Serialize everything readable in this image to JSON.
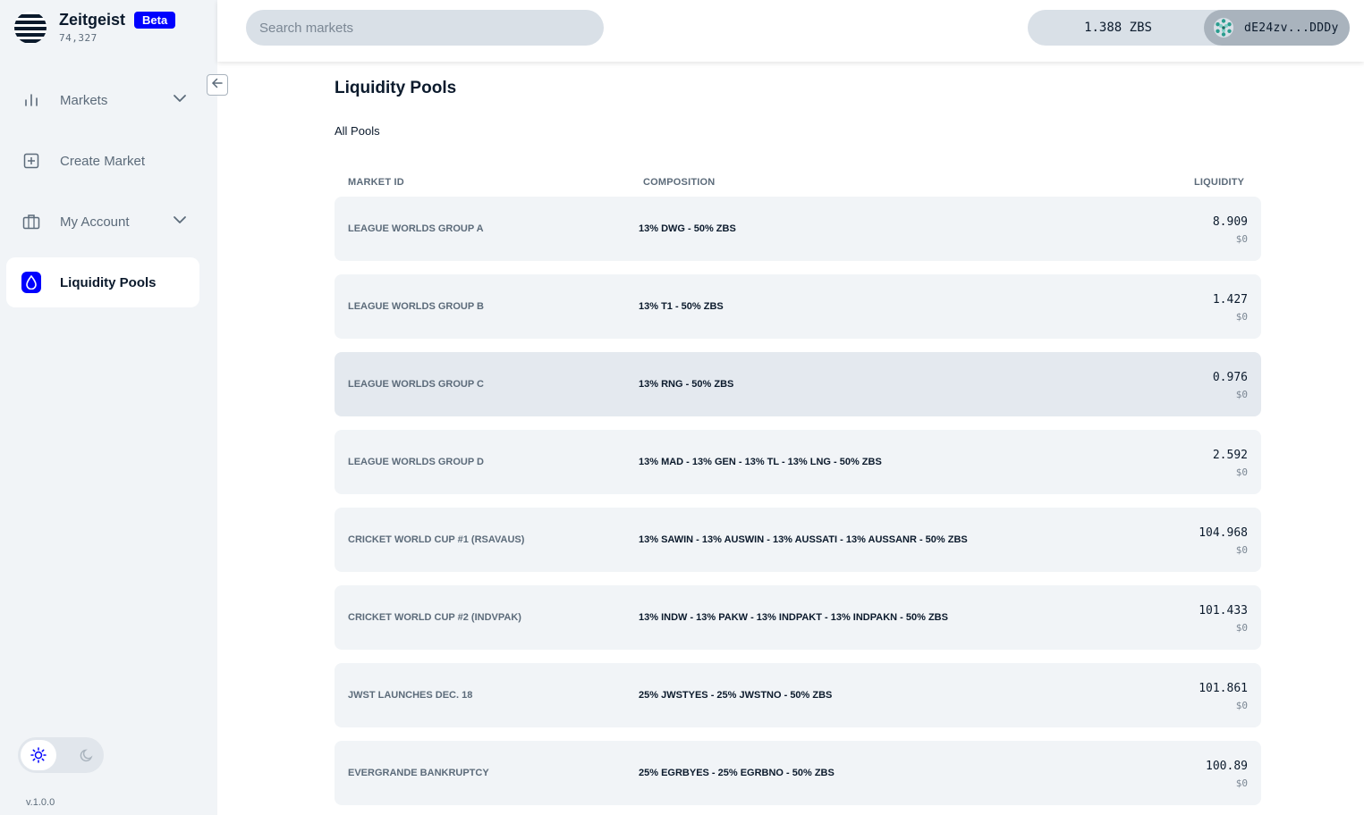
{
  "brand": {
    "name": "Zeitgeist",
    "badge": "Beta",
    "block_number": "74,327"
  },
  "sidebar": {
    "items": [
      {
        "label": "Markets",
        "icon": "bar-chart-icon",
        "has_dropdown": true,
        "active": false
      },
      {
        "label": "Create Market",
        "icon": "plus-square-icon",
        "has_dropdown": false,
        "active": false
      },
      {
        "label": "My Account",
        "icon": "briefcase-icon",
        "has_dropdown": true,
        "active": false
      },
      {
        "label": "Liquidity Pools",
        "icon": "droplet-icon",
        "has_dropdown": false,
        "active": true
      }
    ],
    "theme": {
      "selected": "light"
    },
    "version": "v.1.0.0"
  },
  "header": {
    "search_placeholder": "Search markets",
    "balance": "1.388 ZBS",
    "address": "dE24zv...DDDy"
  },
  "main": {
    "title": "Liquidity Pools",
    "subtitle": "All Pools",
    "columns": {
      "market_id": "MARKET ID",
      "composition": "COMPOSITION",
      "liquidity": "LIQUIDITY"
    },
    "pools": [
      {
        "market_id": "LEAGUE WORLDS GROUP A",
        "composition": "13% DWG - 50% ZBS",
        "liquidity": "8.909",
        "usd": "$0"
      },
      {
        "market_id": "LEAGUE WORLDS GROUP B",
        "composition": "13% T1 - 50% ZBS",
        "liquidity": "1.427",
        "usd": "$0"
      },
      {
        "market_id": "LEAGUE WORLDS GROUP C",
        "composition": "13% RNG - 50% ZBS",
        "liquidity": "0.976",
        "usd": "$0"
      },
      {
        "market_id": "LEAGUE WORLDS GROUP D",
        "composition": "13% MAD - 13% GEN - 13% TL - 13% LNG - 50% ZBS",
        "liquidity": "2.592",
        "usd": "$0"
      },
      {
        "market_id": "CRICKET WORLD CUP #1 (RSAVAUS)",
        "composition": "13% SAWIN - 13% AUSWIN - 13% AUSSATI - 13% AUSSANR - 50% ZBS",
        "liquidity": "104.968",
        "usd": "$0"
      },
      {
        "market_id": "CRICKET WORLD CUP #2 (INDVPAK)",
        "composition": "13% INDW - 13% PAKW - 13% INDPAKT - 13% INDPAKN - 50% ZBS",
        "liquidity": "101.433",
        "usd": "$0"
      },
      {
        "market_id": "JWST LAUNCHES DEC. 18",
        "composition": "25% JWSTYES - 25% JWSTNO - 50% ZBS",
        "liquidity": "101.861",
        "usd": "$0"
      },
      {
        "market_id": "EVERGRANDE BANKRUPTCY",
        "composition": "25% EGRBYES - 25% EGRBNO - 50% ZBS",
        "liquidity": "100.89",
        "usd": "$0"
      }
    ]
  },
  "colors": {
    "accent": "#0001fe",
    "sidebar_bg": "#f1f4f7",
    "row_bg": "#f1f4f7",
    "text": "#0b1a2c",
    "muted": "#5c6b7a"
  }
}
